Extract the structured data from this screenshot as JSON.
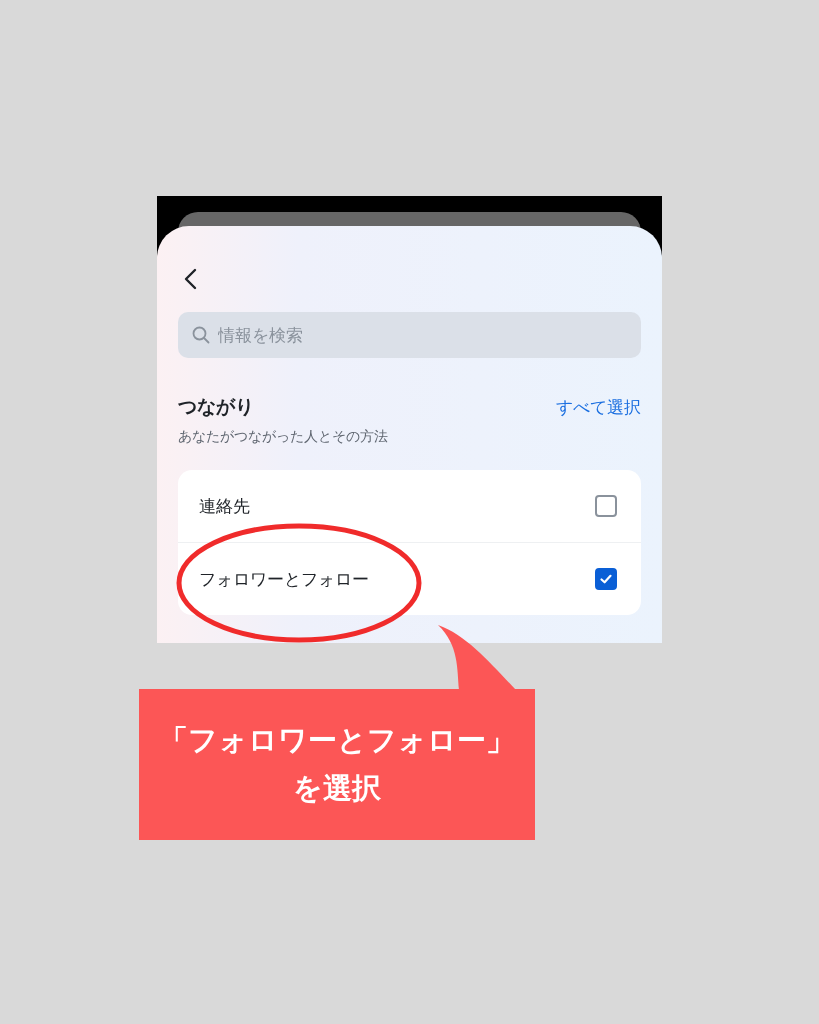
{
  "screen": {
    "search": {
      "placeholder": "情報を検索"
    },
    "section": {
      "title": "つながり",
      "select_all": "すべて選択",
      "subtitle": "あなたがつながった人とその方法"
    },
    "items": [
      {
        "label": "連絡先",
        "checked": false,
        "circled": false
      },
      {
        "label": "フォロワーとフォロー",
        "checked": true,
        "circled": true
      }
    ]
  },
  "callout": {
    "lines": [
      "「フォロワーとフォロー」",
      "を選択"
    ]
  }
}
